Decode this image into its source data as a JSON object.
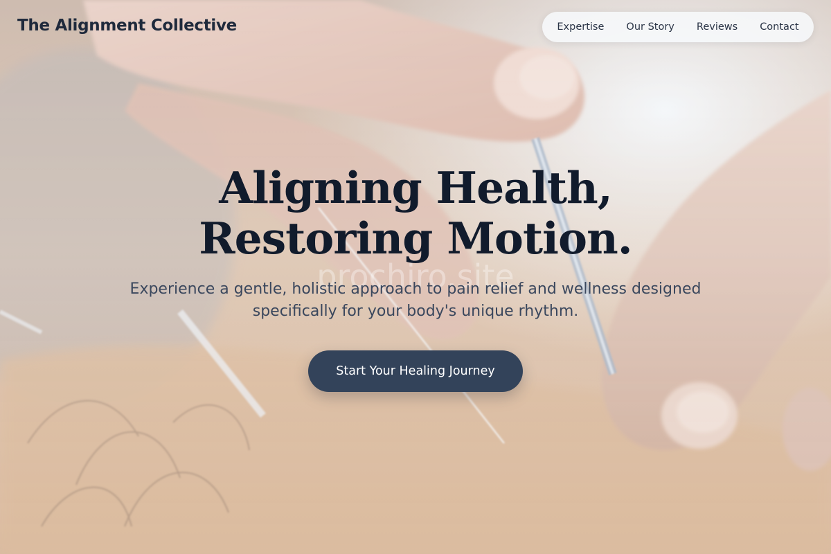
{
  "header": {
    "brand": "The Alignment Collective",
    "nav": [
      {
        "label": "Expertise"
      },
      {
        "label": "Our Story"
      },
      {
        "label": "Reviews"
      },
      {
        "label": "Contact"
      }
    ]
  },
  "hero": {
    "title_line_1": "Aligning Health,",
    "title_line_2": "Restoring Motion.",
    "subtitle": "Experience a gentle, holistic approach to pain relief and wellness designed specifically for your body's unique rhythm.",
    "cta_label": "Start Your Healing Journey",
    "watermark": "prochiro.site",
    "background_image": "acupuncture-needles-photo"
  },
  "colors": {
    "brand_text": "#1f2a3c",
    "title_text": "#111b2c",
    "subtitle_text": "#3a475d",
    "cta_background": "#33435a",
    "cta_text": "#ffffff",
    "nav_background": "#f7f9fc"
  }
}
